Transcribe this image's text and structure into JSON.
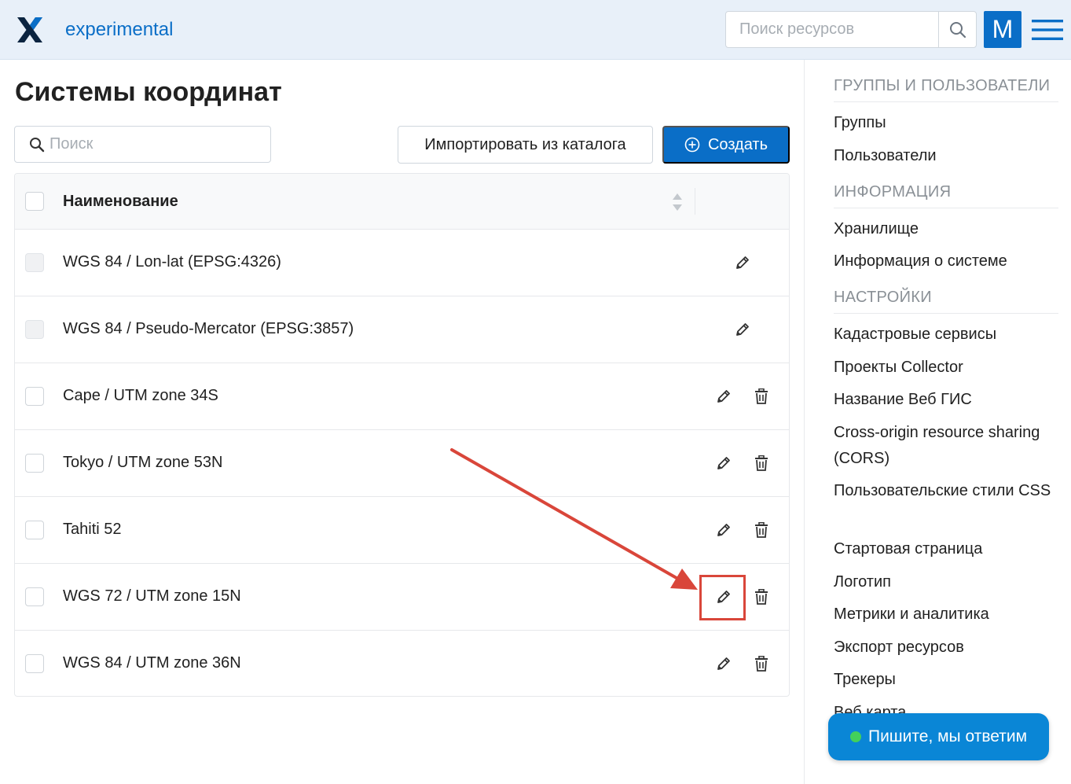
{
  "header": {
    "app_name": "experimental",
    "search_placeholder": "Поиск ресурсов",
    "avatar_letter": "M"
  },
  "main": {
    "title": "Системы координат",
    "filter_placeholder": "Поиск",
    "import_label": "Импортировать из каталога",
    "create_label": "Создать",
    "column_name": "Наименование",
    "rows": [
      {
        "name": "WGS 84 / Lon-lat (EPSG:4326)",
        "deletable": false
      },
      {
        "name": "WGS 84 / Pseudo-Mercator (EPSG:3857)",
        "deletable": false
      },
      {
        "name": "Cape / UTM zone 34S",
        "deletable": true
      },
      {
        "name": "Tokyo / UTM zone 53N",
        "deletable": true
      },
      {
        "name": "Tahiti 52",
        "deletable": true
      },
      {
        "name": "WGS 72 / UTM zone 15N",
        "deletable": true
      },
      {
        "name": "WGS 84 / UTM zone 36N",
        "deletable": true
      }
    ]
  },
  "sidebar": {
    "sections": [
      {
        "title": "ГРУППЫ И ПОЛЬЗОВАТЕЛИ",
        "items": [
          "Группы",
          "Пользователи"
        ]
      },
      {
        "title": "ИНФОРМАЦИЯ",
        "items": [
          "Хранилище",
          "Информация о системе"
        ]
      },
      {
        "title": "НАСТРОЙКИ",
        "items": [
          "Кадастровые сервисы",
          "Проекты Collector",
          "Название Веб ГИС",
          "Cross-origin resource sharing (CORS)",
          "Пользовательские стили CSS",
          "Стартовая страница",
          "Логотип",
          "Метрики и аналитика",
          "Экспорт ресурсов",
          "Трекеры",
          "Веб карта"
        ]
      }
    ]
  },
  "chat": {
    "label": "Пишите, мы ответим"
  },
  "colors": {
    "brand": "#0a6ec7",
    "annotation": "#d9463a"
  }
}
